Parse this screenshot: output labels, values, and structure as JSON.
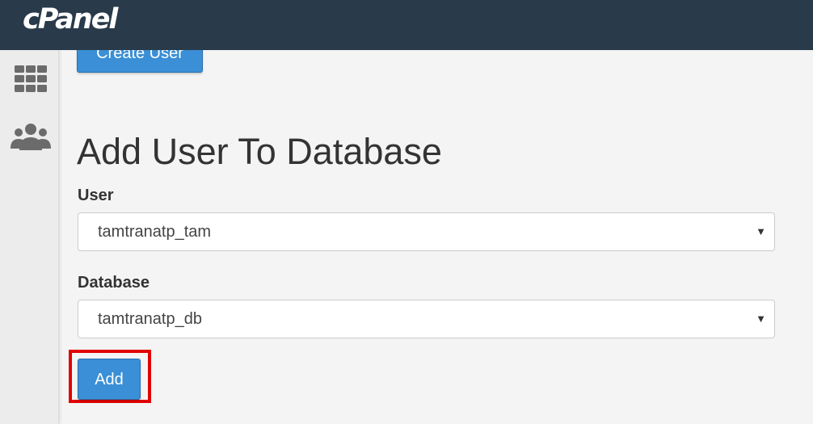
{
  "header": {
    "logo_text": "cPanel"
  },
  "sidebar": {
    "items": [
      {
        "icon": "grid-icon"
      },
      {
        "icon": "users-icon"
      }
    ]
  },
  "main": {
    "create_user_button": "Create User",
    "section_title": "Add User To Database",
    "user_field": {
      "label": "User",
      "value": "tamtranatp_tam"
    },
    "database_field": {
      "label": "Database",
      "value": "tamtranatp_db"
    },
    "add_button": "Add",
    "highlight_color": "#e20000",
    "accent_color": "#3a8fd6"
  }
}
